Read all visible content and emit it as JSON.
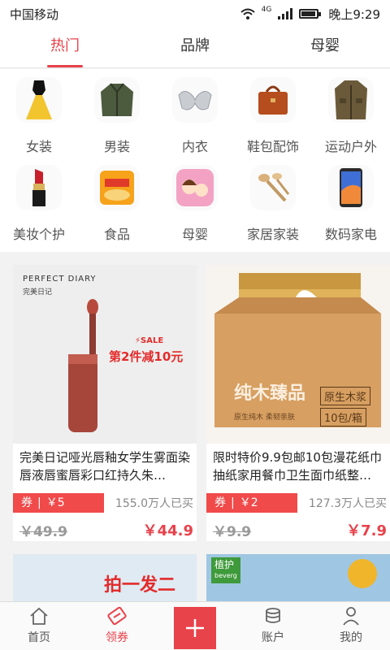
{
  "status": {
    "carrier": "中国移动",
    "network": "4G",
    "time": "晚上9:29"
  },
  "tabs": [
    {
      "label": "热门",
      "active": true
    },
    {
      "label": "品牌",
      "active": false
    },
    {
      "label": "母婴",
      "active": false
    }
  ],
  "categories": [
    {
      "label": "女装",
      "icon": "dress-icon"
    },
    {
      "label": "男装",
      "icon": "jacket-icon"
    },
    {
      "label": "内衣",
      "icon": "bra-icon"
    },
    {
      "label": "鞋包配饰",
      "icon": "handbag-icon"
    },
    {
      "label": "运动户外",
      "icon": "coat-icon"
    },
    {
      "label": "美妆个护",
      "icon": "lipstick-icon"
    },
    {
      "label": "食品",
      "icon": "snack-icon"
    },
    {
      "label": "母婴",
      "icon": "baby-icon"
    },
    {
      "label": "家居家装",
      "icon": "spoons-icon"
    },
    {
      "label": "数码家电",
      "icon": "phone-icon"
    }
  ],
  "products": [
    {
      "title": "完美日记哑光唇釉女学生雾面染唇液唇蜜唇彩口红持久朱…",
      "coupon_label": "券",
      "coupon_value": "￥5",
      "sold": "155.0万人已买",
      "original_price": "￥49.9",
      "price": "￥44.9",
      "image": {
        "brand": "PERFECT DIARY",
        "brand_cn": "完美日记",
        "sale": "SALE",
        "promo": "第2件减10元"
      }
    },
    {
      "title": "限时特价9.9包邮10包漫花纸巾抽纸家用餐巾卫生面巾纸整…",
      "coupon_label": "券",
      "coupon_value": "￥2",
      "sold": "127.3万人已买",
      "original_price": "￥9.9",
      "price": "￥7.9",
      "image": {
        "box_text": "纯木臻品",
        "tag1": "原生木浆",
        "tag2": "10包/箱",
        "small": "原生纯木 柔韧亲肤"
      }
    }
  ],
  "partial_products": [
    {
      "promo": "拍一发二"
    },
    {
      "brand": "植护",
      "brand_en": "beverg"
    }
  ],
  "bottom_nav": [
    {
      "label": "首页",
      "icon": "home-icon",
      "active": false
    },
    {
      "label": "领券",
      "icon": "coupon-icon",
      "active": true
    },
    {
      "label": "",
      "icon": "plus-icon",
      "active": false
    },
    {
      "label": "账户",
      "icon": "coins-icon",
      "active": false
    },
    {
      "label": "我的",
      "icon": "user-icon",
      "active": false
    }
  ],
  "colors": {
    "accent": "#e8424b",
    "coupon": "#f14a4a"
  }
}
